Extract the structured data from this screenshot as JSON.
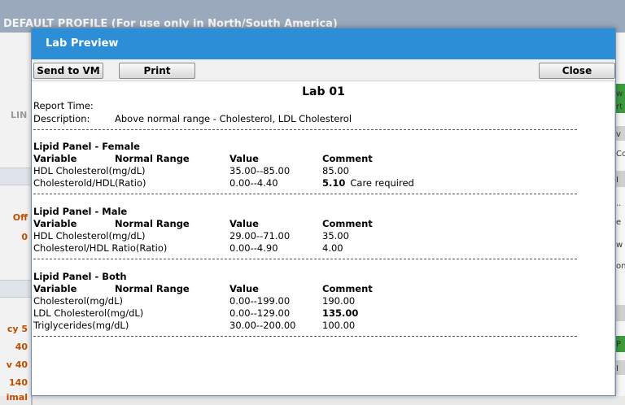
{
  "background": {
    "title": "DEFAULT PROFILE (For use only in North/South America)",
    "lin_label": "LIN",
    "left_items": [
      {
        "text": "Off",
        "style": "item"
      },
      {
        "text": "0",
        "style": "item"
      },
      {
        "text": "cy 5",
        "style": "item"
      },
      {
        "text": "40",
        "style": "item"
      },
      {
        "text": "v 40",
        "style": "item"
      },
      {
        "text": "140",
        "style": "item"
      },
      {
        "text": "imal",
        "style": "item"
      }
    ],
    "right_items": [
      "w",
      "rt",
      "v",
      "Co",
      "I",
      "..",
      "e",
      "w",
      "on",
      "P",
      "I"
    ]
  },
  "dialog": {
    "title": "Lab Preview",
    "buttons": {
      "send": "Send to VM",
      "print": "Print",
      "close": "Close"
    },
    "lab_title": "Lab 01",
    "report_time_label": "Report Time:",
    "description_label": "Description:",
    "description_value": "Above normal range - Cholesterol, LDL Cholesterol",
    "column_headers": {
      "variable": "Variable",
      "normal_range": "Normal Range",
      "value": "Value",
      "comment": "Comment"
    },
    "panels": [
      {
        "title": "Lipid Panel - Female",
        "rows": [
          {
            "variable": "HDL Cholesterol(mg/dL)",
            "range": "35.00--85.00",
            "value": "85.00",
            "note": ""
          },
          {
            "variable": "Cholesterold/HDL(Ratio)",
            "range": "0.00--4.40",
            "value": "5.10",
            "note": "Care required",
            "bold": true
          }
        ]
      },
      {
        "title": "Lipid Panel - Male",
        "rows": [
          {
            "variable": "HDL Cholesterol(mg/dL)",
            "range": "29.00--71.00",
            "value": "35.00",
            "note": ""
          },
          {
            "variable": "Cholesterol/HDL Ratio(Ratio)",
            "range": "0.00--4.90",
            "value": "4.00",
            "note": ""
          }
        ]
      },
      {
        "title": "Lipid Panel - Both",
        "rows": [
          {
            "variable": "Cholesterol(mg/dL)",
            "range": "0.00--199.00",
            "value": "190.00",
            "note": ""
          },
          {
            "variable": "LDL Cholesterol(mg/dL)",
            "range": "0.00--129.00",
            "value": "135.00",
            "note": "",
            "bold": true
          },
          {
            "variable": "Triglycerides(mg/dL)",
            "range": "30.00--200.00",
            "value": "100.00",
            "note": ""
          }
        ]
      }
    ]
  }
}
